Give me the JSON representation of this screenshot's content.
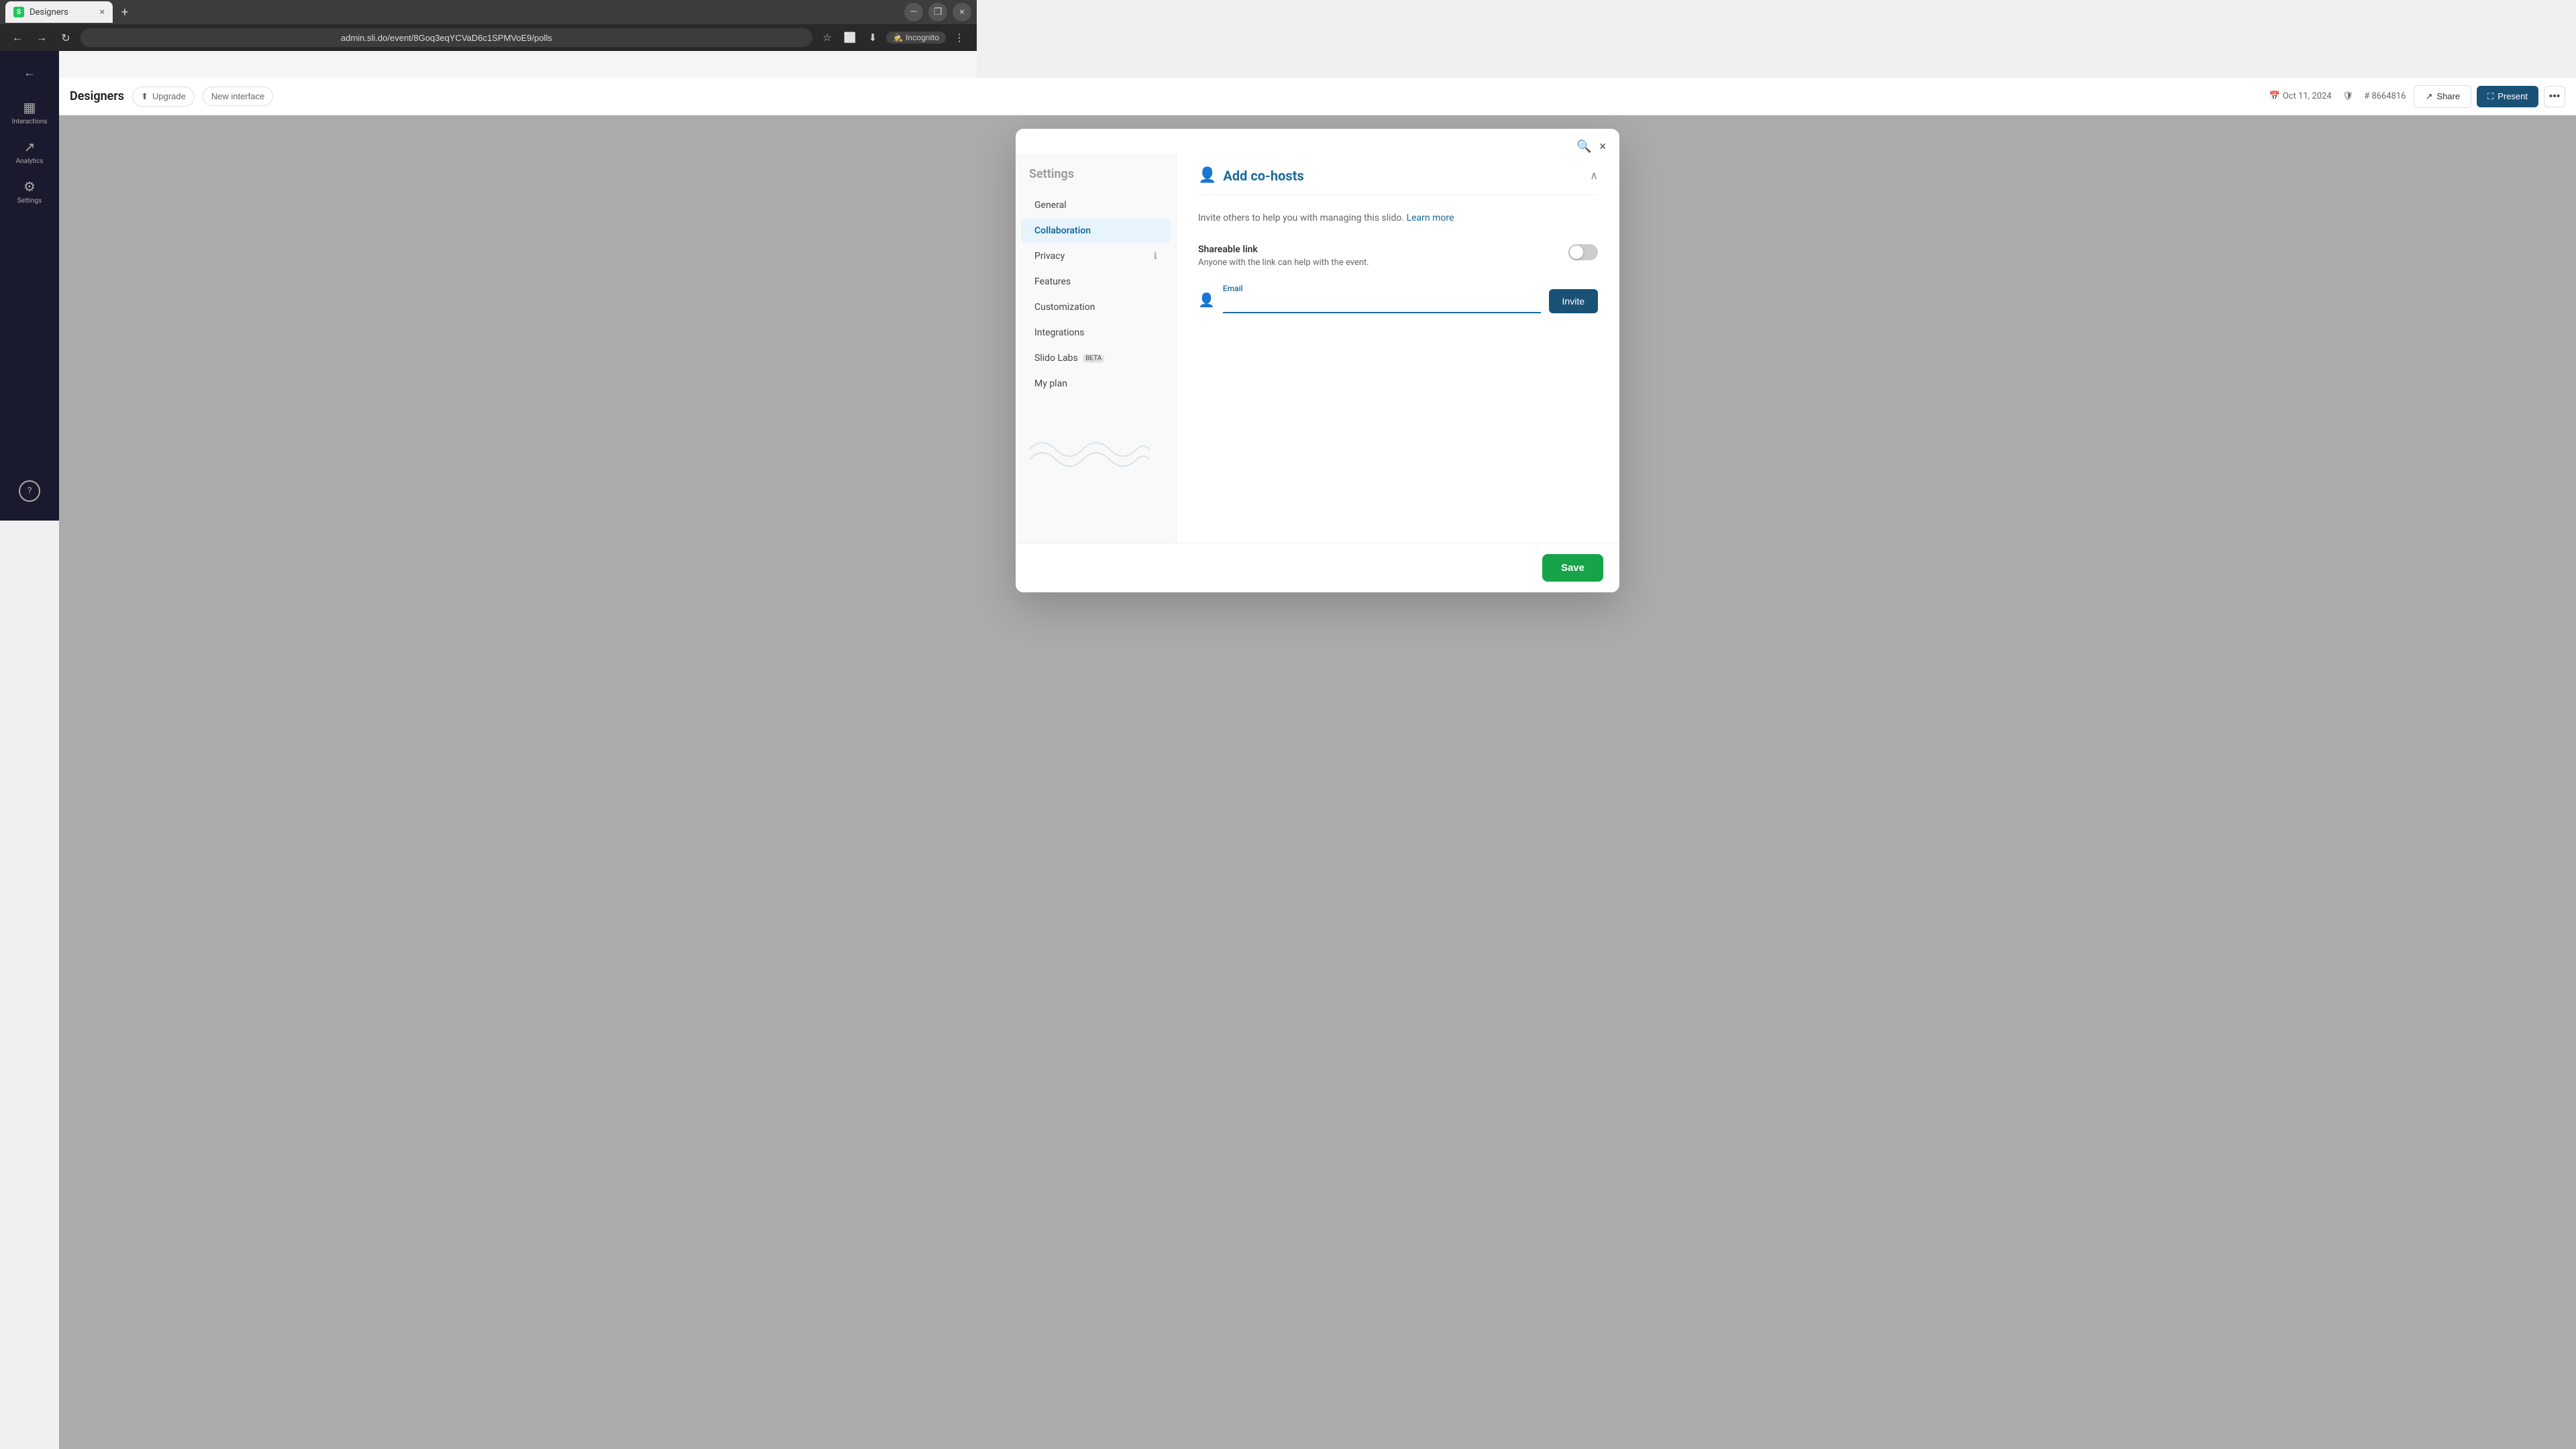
{
  "browser": {
    "tab_favicon": "S",
    "tab_title": "Designers",
    "tab_close": "×",
    "new_tab": "+",
    "nav_back": "←",
    "nav_forward": "→",
    "nav_reload": "↻",
    "address_url": "admin.sli.do/event/8Goq3eqYCVaD6c1SPMVoE9/polls",
    "incognito_label": "Incognito",
    "minimize": "—",
    "restore": "❐",
    "close_window": "×"
  },
  "topbar": {
    "title": "Designers",
    "upgrade_label": "Upgrade",
    "new_interface_label": "New interface",
    "date": "Oct 11, 2024",
    "event_code": "# 8664816",
    "share_label": "Share",
    "present_label": "Present",
    "more_icon": "•••"
  },
  "sidebar": {
    "back_icon": "←",
    "items": [
      {
        "id": "interactions",
        "label": "Interactions",
        "icon": "▦"
      },
      {
        "id": "analytics",
        "label": "Analytics",
        "icon": "↗"
      },
      {
        "id": "settings",
        "label": "Settings",
        "icon": "⚙"
      }
    ],
    "help_label": "?"
  },
  "modal": {
    "search_icon": "🔍",
    "close_icon": "×",
    "settings_title": "Settings",
    "nav_items": [
      {
        "id": "general",
        "label": "General",
        "active": false
      },
      {
        "id": "collaboration",
        "label": "Collaboration",
        "active": true
      },
      {
        "id": "privacy",
        "label": "Privacy",
        "active": false,
        "has_icon": true
      },
      {
        "id": "features",
        "label": "Features",
        "active": false
      },
      {
        "id": "customization",
        "label": "Customization",
        "active": false
      },
      {
        "id": "integrations",
        "label": "Integrations",
        "active": false
      },
      {
        "id": "slido-labs",
        "label": "Slido Labs",
        "active": false,
        "badge": "BETA"
      },
      {
        "id": "my-plan",
        "label": "My plan",
        "active": false
      }
    ],
    "section_title": "Add co-hosts",
    "section_icon": "👤",
    "invite_description": "Invite others to help you with managing this slido.",
    "learn_more_label": "Learn more",
    "shareable_link_title": "Shareable link",
    "shareable_link_desc": "Anyone with the link can help with the event.",
    "toggle_on": false,
    "email_label": "Email",
    "email_placeholder": "",
    "email_value": "",
    "invite_button_label": "Invite",
    "save_button_label": "Save"
  }
}
